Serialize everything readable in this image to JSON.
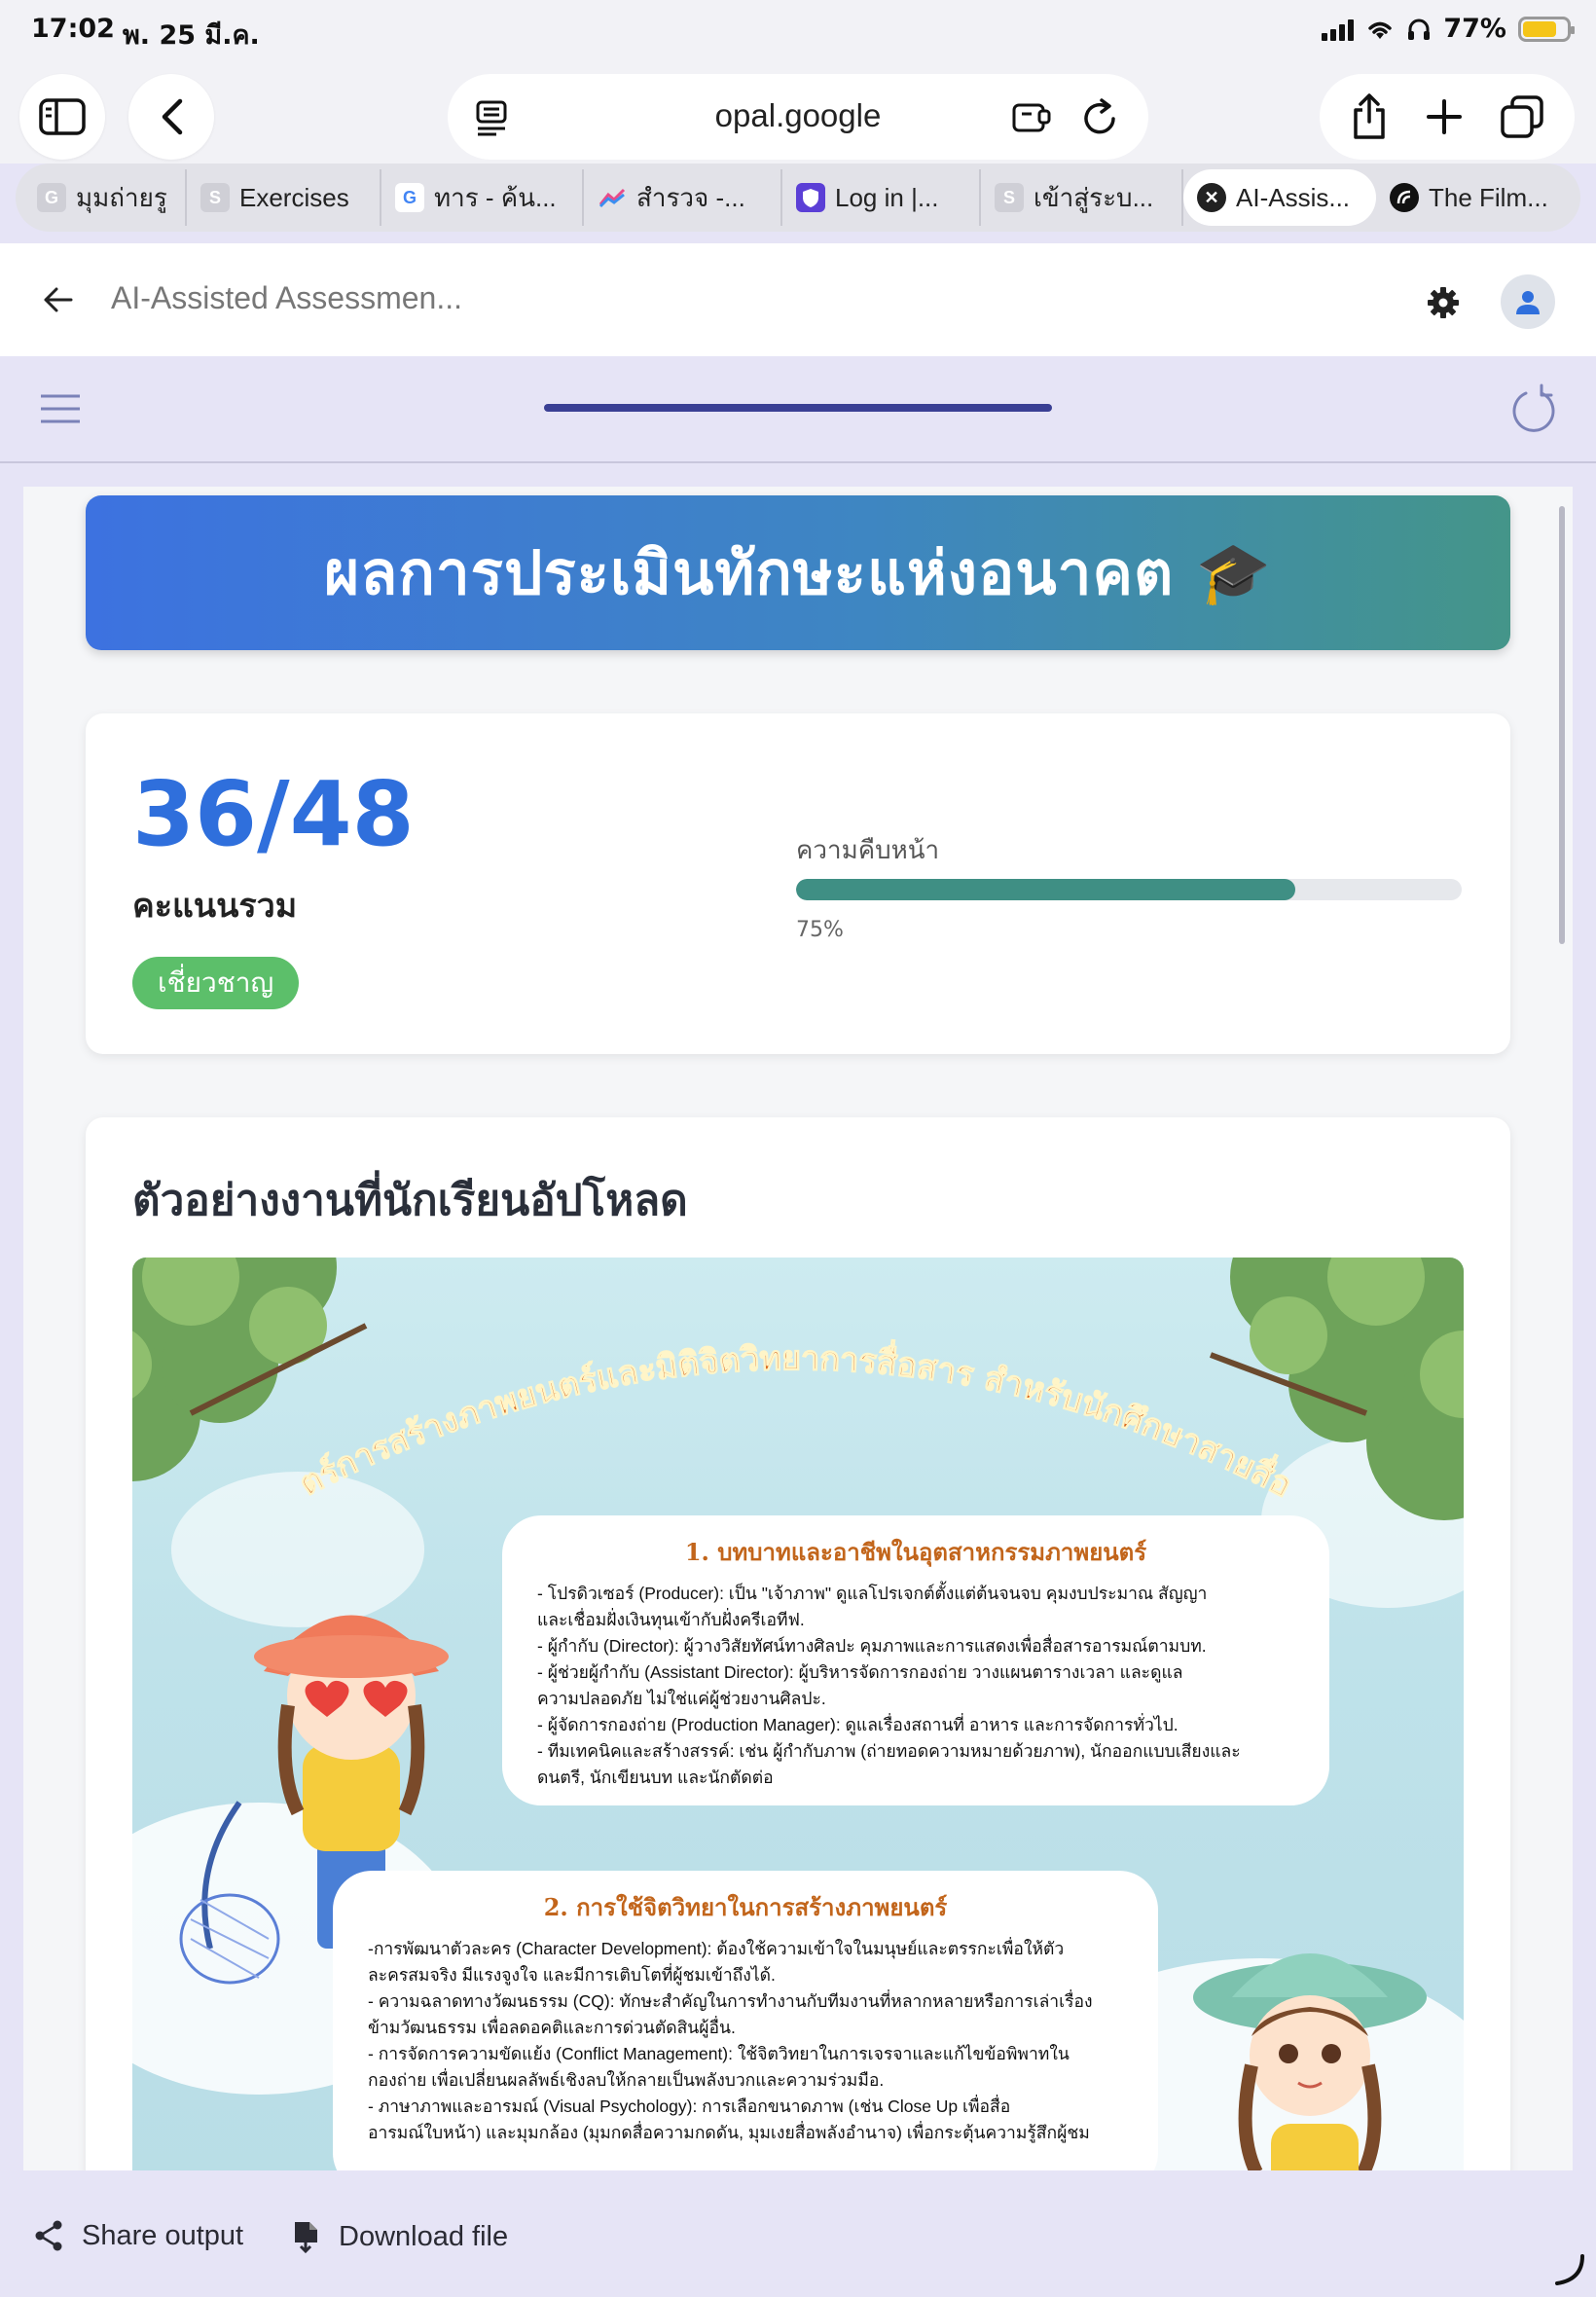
{
  "status_bar": {
    "time": "17:02",
    "date": "พ. 25 มี.ค.",
    "battery_pct": "77%",
    "battery_level": 0.77
  },
  "browser": {
    "url": "opal.google",
    "tabs": [
      {
        "label": "มุมถ่ายรู",
        "favicon": "G",
        "color": "#cfcfd6"
      },
      {
        "label": "Exercises",
        "favicon": "S",
        "color": "#cfcfd6"
      },
      {
        "label": "ทาร - ค้น...",
        "favicon": "G",
        "color": "#ffffff"
      },
      {
        "label": "สำรวจ -...",
        "favicon": "chart",
        "color": "#ffffff"
      },
      {
        "label": "Log in |...",
        "favicon": "shield",
        "color": "#5b3fd6"
      },
      {
        "label": "เข้าสู่ระบ...",
        "favicon": "S",
        "color": "#cfcfd6"
      },
      {
        "label": "AI-Assis...",
        "favicon": "close",
        "color": "#222222",
        "active": true
      },
      {
        "label": "The Film...",
        "favicon": "circle",
        "color": "#111111"
      }
    ]
  },
  "app_header": {
    "title": "AI-Assisted Assessmen..."
  },
  "result": {
    "banner_title": "ผลการประเมินทักษะแห่งอนาคต 🎓",
    "score": "36/48",
    "score_label": "คะแนนรวม",
    "level": "เชี่ยวชาญ",
    "progress_label": "ความคืบหน้า",
    "progress_pct": "75%",
    "progress_value": 0.75
  },
  "work": {
    "title": "ตัวอย่างงานที่นักเรียนอัปโหลด",
    "poster": {
      "headline": "ศาสตร์การสร้างภาพยนตร์และมิติจิตวิทยาการสื่อสาร สำหรับนักศึกษาสายสื่อสาร",
      "section1": {
        "heading": "1. บทบาทและอาชีพในอุตสาหกรรมภาพยนตร์",
        "lines": [
          "- โปรดิวเซอร์ (Producer): เป็น \"เจ้าภาพ\" ดูแลโปรเจกต์ตั้งแต่ต้นจนจบ คุมงบประมาณ สัญญา",
          "และเชื่อมฝั่งเงินทุนเข้ากับฝั่งครีเอทีฟ.",
          "- ผู้กำกับ (Director): ผู้วางวิสัยทัศน์ทางศิลปะ คุมภาพและการแสดงเพื่อสื่อสารอารมณ์ตามบท.",
          "- ผู้ช่วยผู้กำกับ (Assistant Director): ผู้บริหารจัดการกองถ่าย วางแผนตารางเวลา และดูแล",
          "ความปลอดภัย ไม่ใช่แค่ผู้ช่วยงานศิลปะ.",
          "- ผู้จัดการกองถ่าย (Production Manager): ดูแลเรื่องสถานที่ อาหาร และการจัดการทั่วไป.",
          "- ทีมเทคนิคและสร้างสรรค์: เช่น ผู้กำกับภาพ (ถ่ายทอดความหมายด้วยภาพ), นักออกแบบเสียงและ",
          "ดนตรี, นักเขียนบท และนักตัดต่อ"
        ]
      },
      "section2": {
        "heading": "2. การใช้จิตวิทยาในการสร้างภาพยนตร์",
        "lines": [
          "-การพัฒนาตัวละคร (Character Development): ต้องใช้ความเข้าใจในมนุษย์และตรรกะเพื่อให้ตัว",
          "ละครสมจริง มีแรงจูงใจ และมีการเติบโตที่ผู้ชมเข้าถึงได้.",
          "-  ความฉลาดทางวัฒนธรรม (CQ): ทักษะสำคัญในการทำงานกับทีมงานที่หลากหลายหรือการเล่าเรื่อง",
          "ข้ามวัฒนธรรม เพื่อลดอคติและการด่วนตัดสินผู้อื่น.",
          "- การจัดการความขัดแย้ง (Conflict Management): ใช้จิตวิทยาในการเจรจาและแก้ไขข้อพิพาทใน",
          "กองถ่าย เพื่อเปลี่ยนผลลัพธ์เชิงลบให้กลายเป็นพลังบวกและความร่วมมือ.",
          "- ภาษาภาพและอารมณ์ (Visual Psychology): การเลือกขนาดภาพ (เช่น Close Up เพื่อสื่อ",
          "อารมณ์ใบหน้า) และมุมกล้อง (มุมกดสื่อความกดดัน, มุมเงยสื่อพลังอำนาจ) เพื่อกระตุ้นความรู้สึกผู้ชม"
        ]
      }
    }
  },
  "bottom_bar": {
    "share_label": "Share output",
    "download_label": "Download file"
  },
  "colors": {
    "accent_blue": "#2f6fdc",
    "badge_green": "#5cbf6a",
    "progress_teal": "#3f8f84",
    "app_bg": "#e6e4f6"
  }
}
